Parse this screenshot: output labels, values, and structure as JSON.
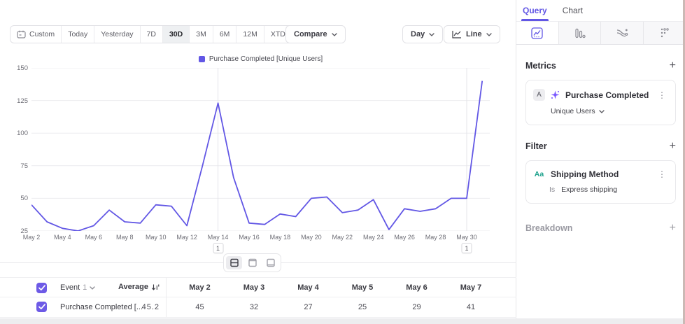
{
  "toolbar": {
    "ranges": [
      {
        "label": "Custom",
        "icon": "calendar-icon"
      },
      {
        "label": "Today"
      },
      {
        "label": "Yesterday"
      },
      {
        "label": "7D"
      },
      {
        "label": "30D",
        "active": true
      },
      {
        "label": "3M"
      },
      {
        "label": "6M"
      },
      {
        "label": "12M"
      },
      {
        "label": "XTD",
        "chevron": true
      }
    ],
    "compare_label": "Compare",
    "granularity_label": "Day",
    "chart_type_label": "Line"
  },
  "legend": {
    "label": "Purchase Completed [Unique Users]",
    "color": "#6257e5"
  },
  "chart_data": {
    "type": "line",
    "title": "Purchase Completed [Unique Users]",
    "x": [
      "May 2",
      "May 3",
      "May 4",
      "May 5",
      "May 6",
      "May 7",
      "May 8",
      "May 9",
      "May 10",
      "May 11",
      "May 12",
      "May 13",
      "May 14",
      "May 15",
      "May 16",
      "May 17",
      "May 18",
      "May 19",
      "May 20",
      "May 21",
      "May 22",
      "May 23",
      "May 24",
      "May 25",
      "May 26",
      "May 27",
      "May 28",
      "May 29",
      "May 30",
      "May 31"
    ],
    "series": [
      {
        "name": "Purchase Completed [Unique Users]",
        "color": "#6257e5",
        "values": [
          45,
          32,
          27,
          25,
          29,
          41,
          32,
          31,
          45,
          44,
          29,
          75,
          123,
          66,
          31,
          30,
          38,
          36,
          50,
          51,
          39,
          41,
          49,
          26,
          42,
          40,
          42,
          50,
          50,
          140
        ]
      }
    ],
    "yticks": [
      150,
      125,
      100,
      75,
      50,
      25
    ],
    "ylim": [
      25,
      150
    ],
    "xtick_labels": [
      "May 2",
      "May 4",
      "May 6",
      "May 8",
      "May 10",
      "May 12",
      "May 14",
      "May 16",
      "May 18",
      "May 20",
      "May 22",
      "May 24",
      "May 26",
      "May 28",
      "May 30"
    ],
    "grid": "horizontal gridlines; vertical lines only at annotated dates",
    "legend_position": "top-center",
    "annotations": [
      {
        "x": "May 14",
        "label": "1"
      },
      {
        "x": "May 30",
        "label": "1"
      }
    ]
  },
  "layout_toggle": {
    "options": [
      "split-view",
      "chart-view",
      "table-view"
    ],
    "active": "split-view"
  },
  "table": {
    "event_selector": {
      "label": "Event",
      "count": "1"
    },
    "average_header": "Average",
    "date_columns": [
      "May 2",
      "May 3",
      "May 4",
      "May 5",
      "May 6",
      "May 7"
    ],
    "rows": [
      {
        "name": "Purchase Completed [...",
        "average": "45.2",
        "values": [
          "45",
          "32",
          "27",
          "25",
          "29",
          "41"
        ],
        "checked": true
      }
    ]
  },
  "sidebar": {
    "tabs": [
      {
        "label": "Query",
        "active": true
      },
      {
        "label": "Chart",
        "active": false
      }
    ],
    "report_types": [
      "insights",
      "funnels",
      "flows",
      "retention"
    ],
    "active_report_type": "insights",
    "metrics": {
      "heading": "Metrics",
      "items": [
        {
          "letter": "A",
          "name": "Purchase Completed",
          "measurement": "Unique Users"
        }
      ]
    },
    "filter": {
      "heading": "Filter",
      "items": [
        {
          "badge": "Aa",
          "name": "Shipping Method",
          "operator": "Is",
          "value": "Express shipping"
        }
      ]
    },
    "breakdown": {
      "heading": "Breakdown"
    }
  },
  "colors": {
    "accent": "#6257e5",
    "event_icon": "#7856ff",
    "filter_badge_green": "#1fa28d"
  }
}
